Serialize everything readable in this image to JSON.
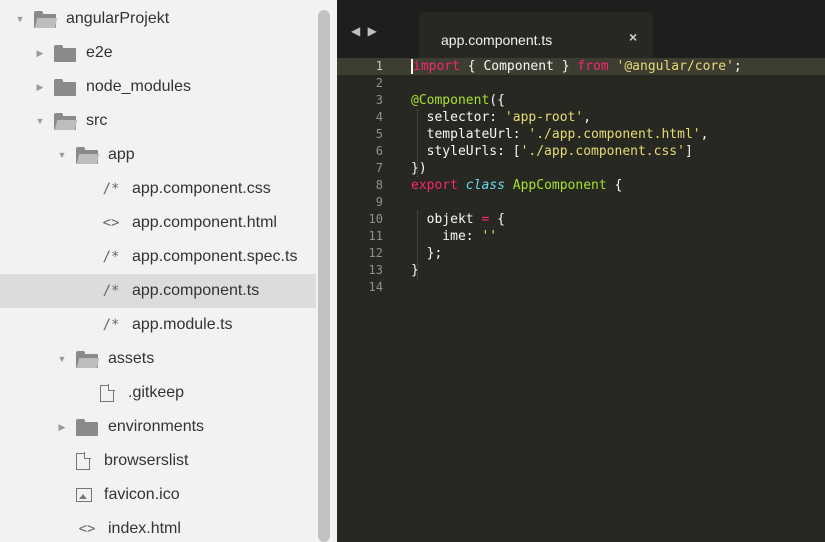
{
  "sidebar": {
    "items": [
      {
        "label": "angularProjekt",
        "kind": "folder-open",
        "indent": 0,
        "disclosure": "▼"
      },
      {
        "label": "e2e",
        "kind": "folder",
        "indent": 1,
        "disclosure": "▶"
      },
      {
        "label": "node_modules",
        "kind": "folder",
        "indent": 1,
        "disclosure": "▶"
      },
      {
        "label": "src",
        "kind": "folder-open",
        "indent": 1,
        "disclosure": "▼"
      },
      {
        "label": "app",
        "kind": "folder-open",
        "indent": 2,
        "disclosure": "▼"
      },
      {
        "label": "app.component.css",
        "kind": "code-comment",
        "indent": 3,
        "glyph": "/*"
      },
      {
        "label": "app.component.html",
        "kind": "code-tag",
        "indent": 3,
        "glyph": "<>"
      },
      {
        "label": "app.component.spec.ts",
        "kind": "code-comment",
        "indent": 3,
        "glyph": "/*"
      },
      {
        "label": "app.component.ts",
        "kind": "code-comment",
        "indent": 3,
        "glyph": "/*",
        "selected": true
      },
      {
        "label": "app.module.ts",
        "kind": "code-comment",
        "indent": 3,
        "glyph": "/*"
      },
      {
        "label": "assets",
        "kind": "folder-open",
        "indent": 2,
        "disclosure": "▼"
      },
      {
        "label": ".gitkeep",
        "kind": "doc",
        "indent": 3
      },
      {
        "label": "environments",
        "kind": "folder",
        "indent": 2,
        "disclosure": "▶"
      },
      {
        "label": "browserslist",
        "kind": "doc",
        "indent": 2
      },
      {
        "label": "favicon.ico",
        "kind": "image",
        "indent": 2
      },
      {
        "label": "index.html",
        "kind": "code-tag",
        "indent": 2,
        "glyph": "<>"
      }
    ]
  },
  "editor": {
    "nav_arrows": "◀ ▶",
    "tab": {
      "label": "app.component.ts",
      "close": "×"
    },
    "lines": [
      {
        "n": "1",
        "tokens": [
          [
            "kw",
            "import"
          ],
          [
            "plain",
            " { Component } "
          ],
          [
            "kw",
            "from"
          ],
          [
            "plain",
            " "
          ],
          [
            "str",
            "'@angular/core'"
          ],
          [
            "plain",
            ";"
          ]
        ]
      },
      {
        "n": "2",
        "tokens": []
      },
      {
        "n": "3",
        "tokens": [
          [
            "dec",
            "@Component"
          ],
          [
            "plain",
            "({"
          ]
        ]
      },
      {
        "n": "4",
        "tokens": [
          [
            "plain",
            "  selector: "
          ],
          [
            "str",
            "'app-root'"
          ],
          [
            "plain",
            ","
          ]
        ]
      },
      {
        "n": "5",
        "tokens": [
          [
            "plain",
            "  templateUrl: "
          ],
          [
            "str",
            "'./app.component.html'"
          ],
          [
            "plain",
            ","
          ]
        ]
      },
      {
        "n": "6",
        "tokens": [
          [
            "plain",
            "  styleUrls: ["
          ],
          [
            "str",
            "'./app.component.css'"
          ],
          [
            "plain",
            "]"
          ]
        ]
      },
      {
        "n": "7",
        "tokens": [
          [
            "plain",
            "})"
          ]
        ]
      },
      {
        "n": "8",
        "tokens": [
          [
            "kw",
            "export"
          ],
          [
            "plain",
            " "
          ],
          [
            "stor",
            "class"
          ],
          [
            "plain",
            " "
          ],
          [
            "cls",
            "AppComponent"
          ],
          [
            "plain",
            " {"
          ]
        ]
      },
      {
        "n": "9",
        "tokens": []
      },
      {
        "n": "10",
        "tokens": [
          [
            "plain",
            "  objekt "
          ],
          [
            "kw",
            "="
          ],
          [
            "plain",
            " {"
          ]
        ]
      },
      {
        "n": "11",
        "tokens": [
          [
            "plain",
            "    ime: "
          ],
          [
            "str",
            "''"
          ]
        ]
      },
      {
        "n": "12",
        "tokens": [
          [
            "plain",
            "  };"
          ]
        ]
      },
      {
        "n": "13",
        "tokens": [
          [
            "plain",
            "}"
          ]
        ]
      },
      {
        "n": "14",
        "tokens": []
      }
    ]
  }
}
